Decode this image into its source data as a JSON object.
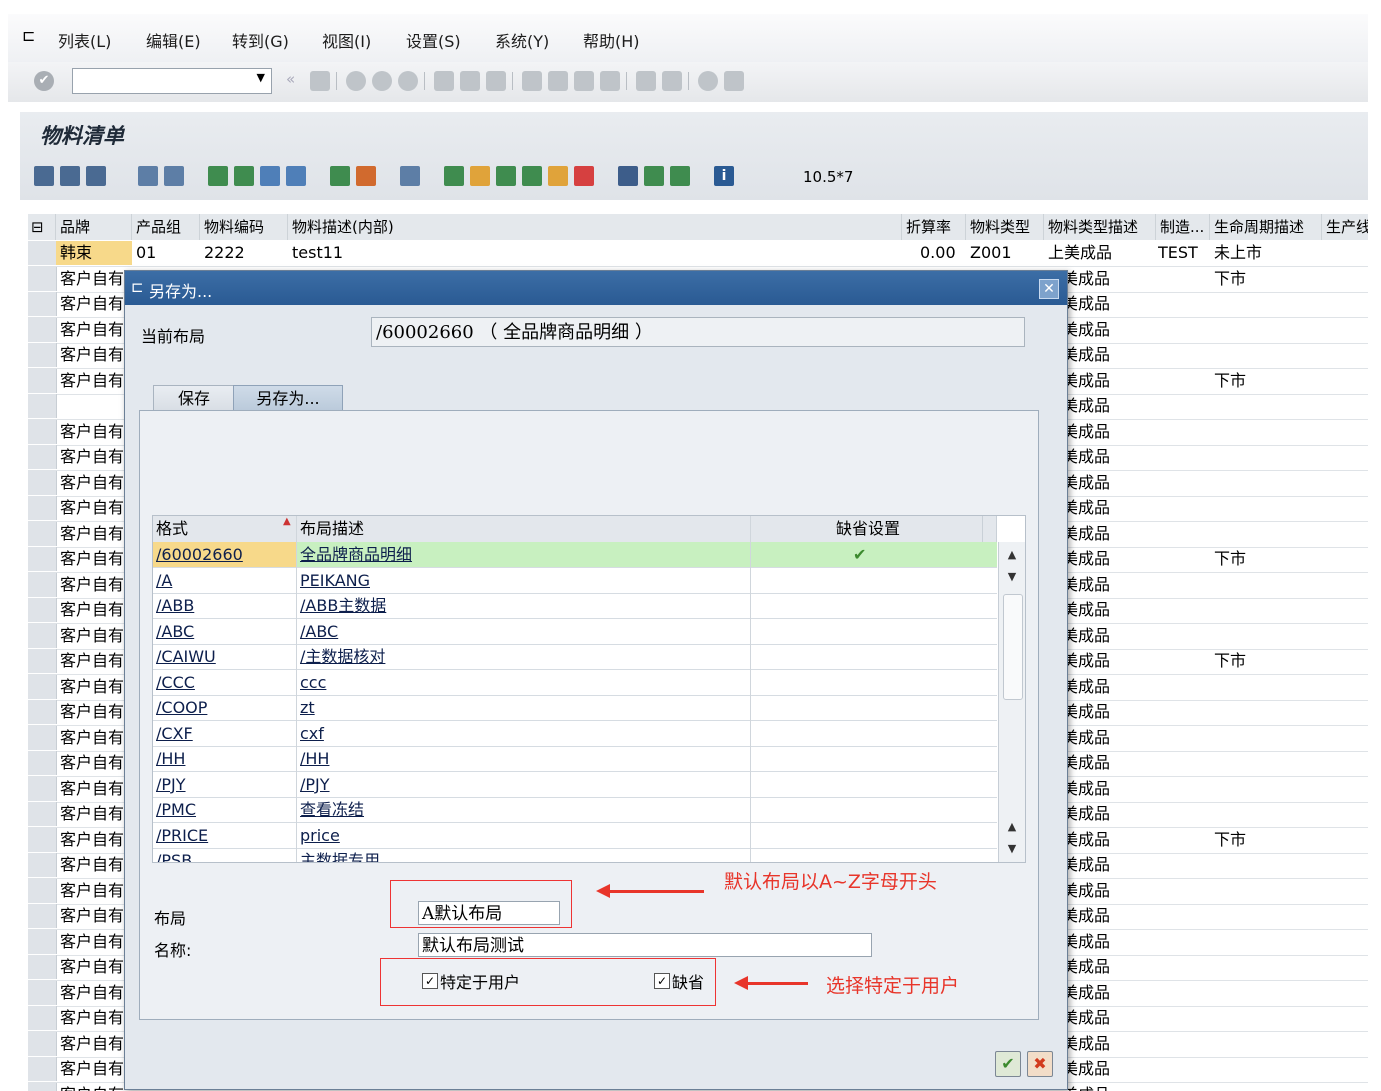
{
  "menu": [
    "列表(L)",
    "编辑(E)",
    "转到(G)",
    "视图(I)",
    "设置(S)",
    "系统(Y)",
    "帮助(H)"
  ],
  "page_title": "物料清单",
  "zoom_label": "10.5*7",
  "grid": {
    "headers": [
      "品牌",
      "产品组",
      "物料编码",
      "物料描述(内部)",
      "折算率",
      "物料类型",
      "物料类型描述",
      "制造...",
      "生命周期描述",
      "生产线"
    ],
    "first_row": {
      "brand": "韩束",
      "group": "01",
      "code": "2222",
      "desc": "test11",
      "rate": "0.00",
      "type": "Z001",
      "type_desc": "上美成品",
      "mfg": "TEST",
      "lifecycle": "未上市"
    },
    "row_brand": "客户自有",
    "row_type_desc": "美成品",
    "lifecycle_down": "下市"
  },
  "dialog": {
    "title": "另存为...",
    "current_layout_label": "当前布局",
    "current_layout_value": "/60002660 （ 全品牌商品明细 ）",
    "tabs": {
      "save": "保存",
      "save_as": "另存为..."
    },
    "table": {
      "headers": {
        "format": "格式",
        "desc": "布局描述",
        "default": "缺省设置"
      },
      "rows": [
        {
          "format": "/60002660",
          "desc": "全品牌商品明细",
          "default": "✔"
        },
        {
          "format": "/A",
          "desc": "PEIKANG",
          "default": ""
        },
        {
          "format": "/ABB",
          "desc": "/ABB主数据",
          "default": ""
        },
        {
          "format": "/ABC",
          "desc": "/ABC",
          "default": ""
        },
        {
          "format": "/CAIWU",
          "desc": "/主数据核对",
          "default": ""
        },
        {
          "format": "/CCC",
          "desc": "ccc",
          "default": ""
        },
        {
          "format": "/COOP",
          "desc": "zt",
          "default": ""
        },
        {
          "format": "/CXF",
          "desc": "cxf",
          "default": ""
        },
        {
          "format": "/HH",
          "desc": "/HH",
          "default": ""
        },
        {
          "format": "/PJY",
          "desc": "/PJY",
          "default": ""
        },
        {
          "format": "/PMC",
          "desc": "查看冻结",
          "default": ""
        },
        {
          "format": "/PRICE",
          "desc": "price",
          "default": ""
        },
        {
          "format": "/PSB",
          "desc": "主数据专用",
          "default": ""
        }
      ]
    },
    "layout_label": "布局",
    "layout_value": "A默认布局",
    "name_label": "名称:",
    "name_value": "默认布局测试",
    "user_specific_label": "特定于用户",
    "default_label": "缺省",
    "confirm_icon": "check-icon",
    "cancel_icon": "cancel-x-icon"
  },
  "annotations": {
    "layout_hint": "默认布局以A~Z字母开头",
    "user_hint": "选择特定于用户"
  },
  "colors": {
    "title_bar": "#2f5f98",
    "selected_row": "#c8f0c0",
    "annotation_red": "#e8352a",
    "brand_cell": "#f7d98a"
  }
}
